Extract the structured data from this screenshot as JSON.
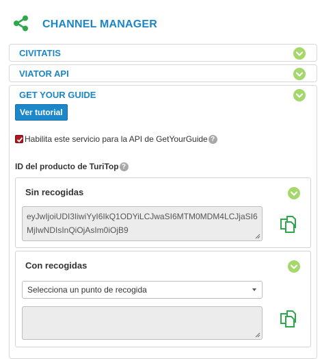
{
  "header": {
    "title": "CHANNEL MANAGER",
    "icon": "share-icon",
    "accent": "#1a86c8",
    "icon_color": "#2aa84a"
  },
  "accordions": [
    {
      "label": "CIVITATIS",
      "state": "collapsed"
    },
    {
      "label": "VIATOR API",
      "state": "collapsed"
    },
    {
      "label": "GET YOUR GUIDE",
      "state": "expanded"
    }
  ],
  "gyg": {
    "tutorial_label": "Ver tutorial",
    "enable_label": "Habilita este servicio para la API de GetYourGuide",
    "enable_checked": true,
    "help_glyph": "?",
    "product_id_label": "ID del producto de TuriTop",
    "without_pickups": {
      "title": "Sin recogidas",
      "value": "eyJwIjoiUDI3IiwiYyI6IkQ1ODYiLCJwaSI6MTM0MDM4LCJjaSI6MjIwNDIsInQiOjAsIm0iOjB9"
    },
    "with_pickups": {
      "title": "Con recogidas",
      "select_selected": "Selecciona un punto de recogida",
      "value": ""
    }
  },
  "colors": {
    "chevron_bg": "#a5d86b",
    "button_bg": "#1d88c9",
    "checkbox": "#b0161d",
    "copy_icon": "#2aa84a"
  }
}
